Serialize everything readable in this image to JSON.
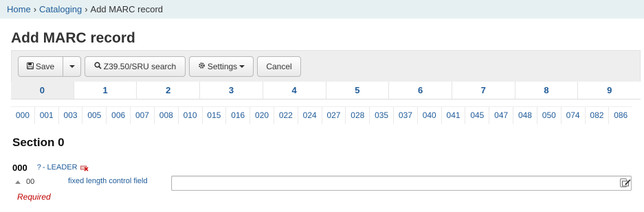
{
  "breadcrumb": {
    "items": [
      "Home",
      "Cataloging",
      "Add MARC record"
    ],
    "separator": "›"
  },
  "page_title": "Add MARC record",
  "toolbar": {
    "save_label": "Save",
    "z3950_label": "Z39.50/SRU search",
    "settings_label": "Settings",
    "cancel_label": "Cancel"
  },
  "tabs": {
    "active": "0",
    "items": [
      "0",
      "1",
      "2",
      "3",
      "4",
      "5",
      "6",
      "7",
      "8",
      "9"
    ]
  },
  "field_nav": [
    "000",
    "001",
    "003",
    "005",
    "006",
    "007",
    "008",
    "010",
    "015",
    "016",
    "020",
    "022",
    "024",
    "027",
    "028",
    "035",
    "037",
    "040",
    "041",
    "045",
    "047",
    "048",
    "050",
    "074",
    "082",
    "086"
  ],
  "section": {
    "title": "Section 0",
    "tag": {
      "number": "000",
      "help": "?",
      "label": "- LEADER",
      "subfield": {
        "code": "00",
        "description": "fixed length control field",
        "value": "",
        "required_text": "Required"
      }
    }
  },
  "colors": {
    "link": "#1f5b99",
    "breadcrumb_bg": "#e6f0f2",
    "toolbar_bg": "#eeeeee",
    "required": "#c00000"
  }
}
